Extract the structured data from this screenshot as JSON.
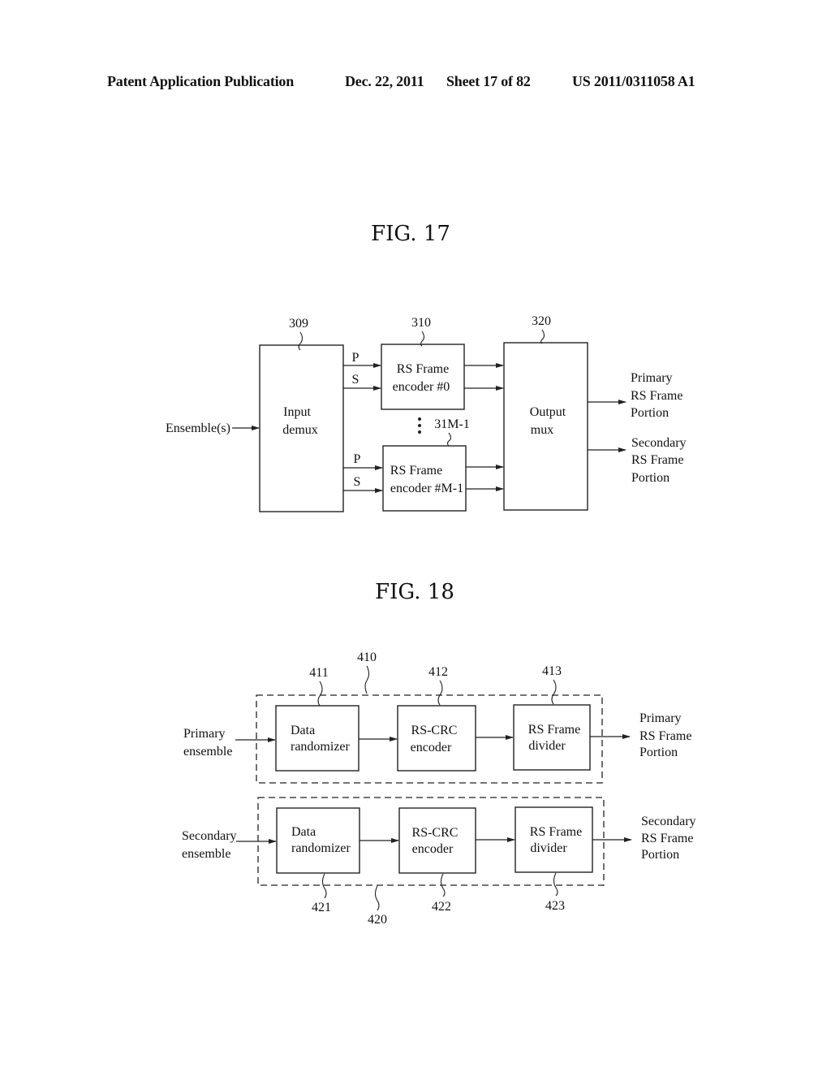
{
  "header": {
    "left": "Patent Application Publication",
    "date": "Dec. 22, 2011",
    "sheet": "Sheet 17 of 82",
    "number": "US 2011/0311058 A1"
  },
  "fig17": {
    "title": "FIG. 17",
    "input_label": "Ensemble(s)",
    "demux": {
      "ref": "309",
      "line1": "Input",
      "line2": "demux"
    },
    "encoder0": {
      "ref": "310",
      "line1": "RS Frame",
      "line2": "encoder #0"
    },
    "encoderM": {
      "ref": "31M-1",
      "line1": "RS Frame",
      "line2": "encoder #M-1"
    },
    "mux": {
      "ref": "320",
      "line1": "Output",
      "line2": "mux"
    },
    "p_label": "P",
    "s_label": "S",
    "ellipsis": "⋮",
    "out_primary": [
      "Primary",
      "RS Frame",
      "Portion"
    ],
    "out_secondary": [
      "Secondary",
      "RS Frame",
      "Portion"
    ]
  },
  "fig18": {
    "title": "FIG. 18",
    "primary": {
      "group_ref": "410",
      "input": [
        "Primary",
        "ensemble"
      ],
      "randomizer": {
        "ref": "411",
        "line1": "Data",
        "line2": "randomizer"
      },
      "rscrc": {
        "ref": "412",
        "line1": "RS-CRC",
        "line2": "encoder"
      },
      "divider": {
        "ref": "413",
        "line1": "RS Frame",
        "line2": "divider"
      },
      "output": [
        "Primary",
        "RS Frame",
        "Portion"
      ]
    },
    "secondary": {
      "group_ref": "420",
      "input": [
        "Secondary",
        "ensemble"
      ],
      "randomizer": {
        "ref": "421",
        "line1": "Data",
        "line2": "randomizer"
      },
      "rscrc": {
        "ref": "422",
        "line1": "RS-CRC",
        "line2": "encoder"
      },
      "divider": {
        "ref": "423",
        "line1": "RS Frame",
        "line2": "divider"
      },
      "output": [
        "Secondary",
        "RS Frame",
        "Portion"
      ]
    }
  }
}
